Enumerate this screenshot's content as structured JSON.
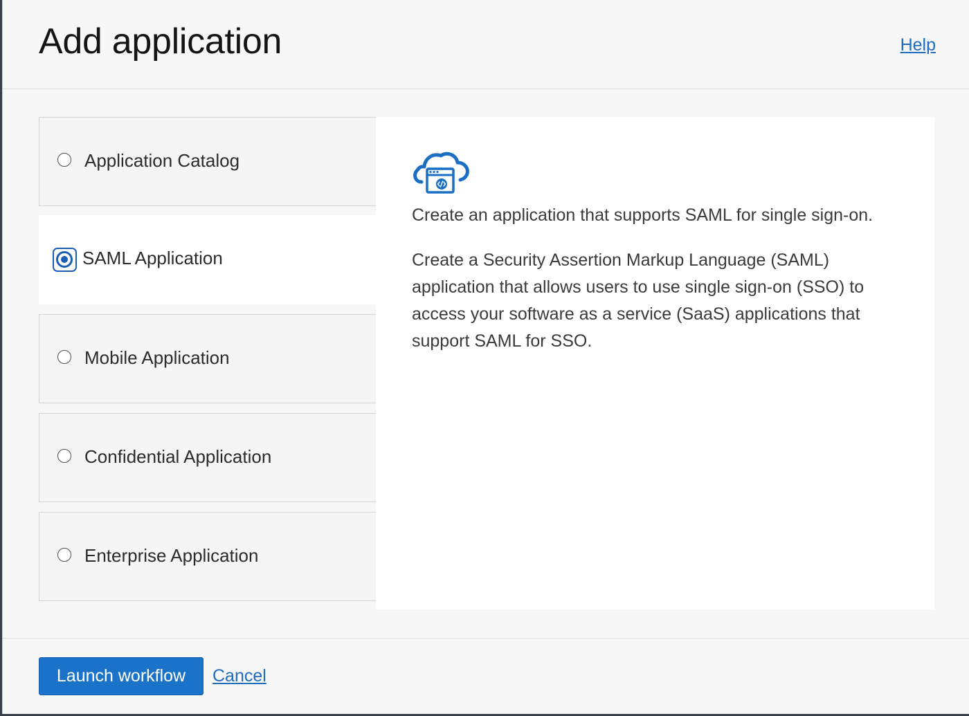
{
  "header": {
    "title": "Add application",
    "help_label": "Help"
  },
  "options": [
    {
      "label": "Application Catalog",
      "selected": false
    },
    {
      "label": "SAML Application",
      "selected": true
    },
    {
      "label": "Mobile Application",
      "selected": false
    },
    {
      "label": "Confidential Application",
      "selected": false
    },
    {
      "label": "Enterprise Application",
      "selected": false
    }
  ],
  "detail": {
    "icon": "cloud-application-icon",
    "summary": "Create an application that supports SAML for single sign-on.",
    "description": "Create a Security Assertion Markup Language (SAML) application that allows users to use single sign-on (SSO) to access your software as a service (SaaS) applications that support SAML for SSO."
  },
  "footer": {
    "launch_label": "Launch workflow",
    "cancel_label": "Cancel"
  },
  "colors": {
    "accent": "#1a73c9",
    "link": "#1f6bbd",
    "selected_radio": "#1a5fb4"
  }
}
